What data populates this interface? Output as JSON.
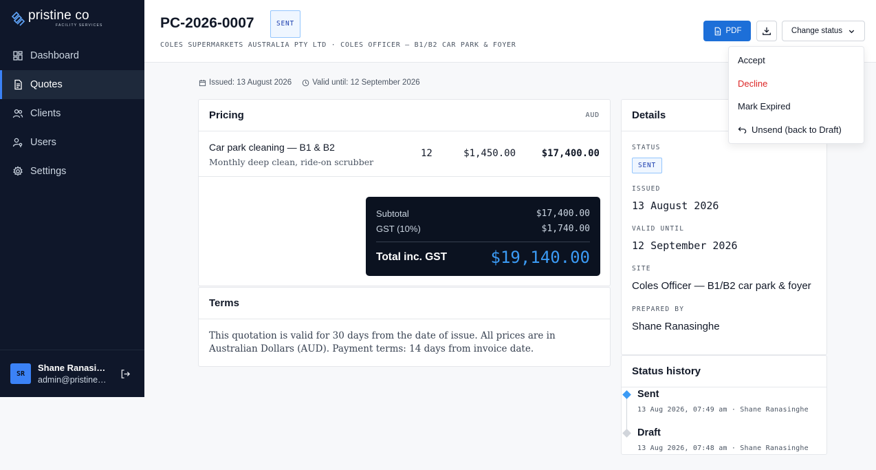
{
  "brand": {
    "name": "pristine co",
    "tagline": "FACILITY SERVICES"
  },
  "nav": [
    {
      "label": "Dashboard",
      "icon": "dashboard-icon",
      "active": false
    },
    {
      "label": "Quotes",
      "icon": "document-icon",
      "active": true
    },
    {
      "label": "Clients",
      "icon": "people-icon",
      "active": false
    },
    {
      "label": "Users",
      "icon": "user-key-icon",
      "active": false
    },
    {
      "label": "Settings",
      "icon": "gear-icon",
      "active": false
    }
  ],
  "user": {
    "initials": "SR",
    "name": "Shane Ranasinghe",
    "email": "admin@pristineco.com.au"
  },
  "header": {
    "quote_number": "PC-2026-0007",
    "status_badge": "SENT",
    "subtitle": "COLES SUPERMARKETS AUSTRALIA PTY LTD · COLES OFFICER — B1/B2 CAR PARK & FOYER",
    "pdf_label": "PDF",
    "change_status_label": "Change status"
  },
  "meta": {
    "issued": "Issued: 13 August 2026",
    "valid_until": "Valid until: 12 September 2026"
  },
  "pricing": {
    "title": "Pricing",
    "currency": "AUD",
    "line_items": [
      {
        "name": "Car park cleaning — B1 & B2",
        "description": "Monthly deep clean, ride-on scrubber",
        "qty": "12",
        "unit_price": "$1,450.00",
        "total": "$17,400.00"
      }
    ],
    "subtotal_label": "Subtotal",
    "subtotal": "$17,400.00",
    "gst_label": "GST (10%)",
    "gst": "$1,740.00",
    "total_label": "Total inc. GST",
    "total": "$19,140.00"
  },
  "terms": {
    "title": "Terms",
    "text": "This quotation is valid for 30 days from the date of issue. All prices are in Australian Dollars (AUD). Payment terms: 14 days from invoice date."
  },
  "details": {
    "title": "Details",
    "status_label": "STATUS",
    "status": "SENT",
    "issued_label": "ISSUED",
    "issued": "13 August 2026",
    "valid_label": "VALID UNTIL",
    "valid": "12 September 2026",
    "site_label": "SITE",
    "site": "Coles Officer — B1/B2 car park & foyer",
    "prepared_label": "PREPARED BY",
    "prepared": "Shane Ranasinghe"
  },
  "history": {
    "title": "Status history",
    "items": [
      {
        "status": "Sent",
        "meta": "13 Aug 2026, 07:49 am · Shane Ranasinghe",
        "color": "#3b9bf5"
      },
      {
        "status": "Draft",
        "meta": "13 Aug 2026, 07:48 am · Shane Ranasinghe",
        "color": "#d1d5db"
      }
    ]
  },
  "status_menu": {
    "accept": "Accept",
    "decline": "Decline",
    "mark_expired": "Mark Expired",
    "unsend": "Unsend (back to Draft)",
    "decline_color": "#dc2626"
  }
}
